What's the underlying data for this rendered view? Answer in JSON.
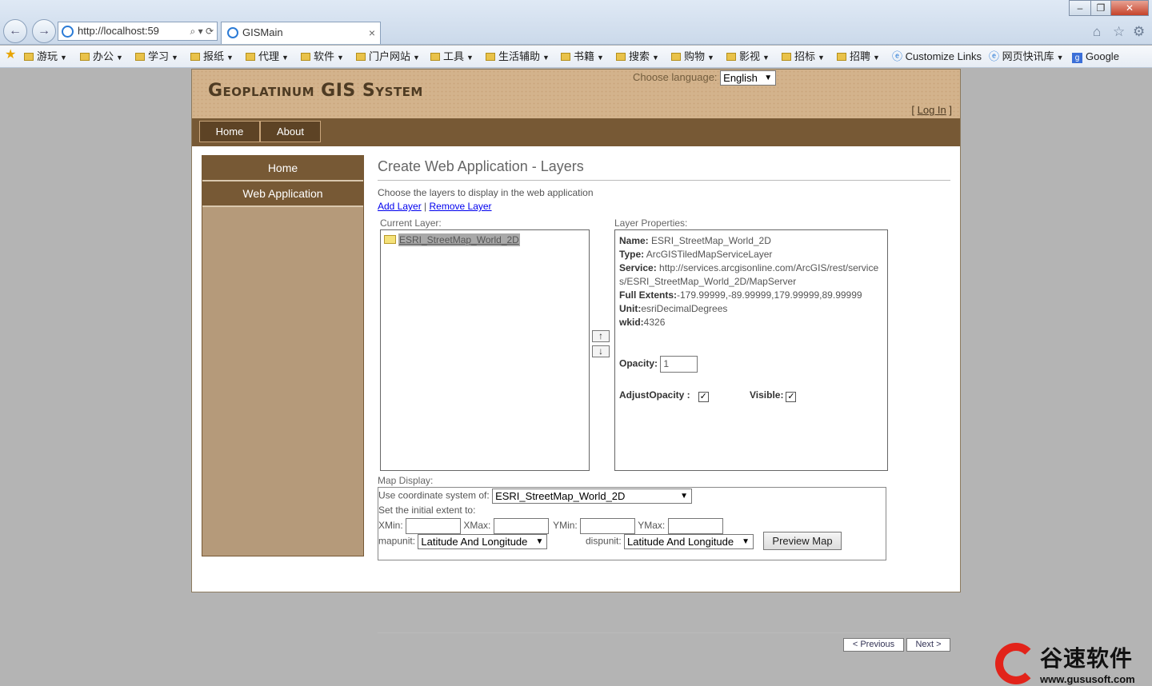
{
  "browser": {
    "address": "http://localhost:59",
    "tab_title": "GISMain",
    "tab_close": "×",
    "window_controls": {
      "minimize": "–",
      "maximize": "❐",
      "close": "✕"
    },
    "favorites": [
      {
        "label": "游玩"
      },
      {
        "label": "办公"
      },
      {
        "label": "学习"
      },
      {
        "label": "报纸"
      },
      {
        "label": "代理"
      },
      {
        "label": "软件"
      },
      {
        "label": "门户网站"
      },
      {
        "label": "工具"
      },
      {
        "label": "生活辅助"
      },
      {
        "label": "书籍"
      },
      {
        "label": "搜索"
      },
      {
        "label": "购物"
      },
      {
        "label": "影视"
      },
      {
        "label": "招标"
      },
      {
        "label": "招聘"
      }
    ],
    "fav_links": {
      "customize": "Customize Links",
      "quick": "网页快讯库",
      "google": "Google"
    }
  },
  "header": {
    "brand": "Geoplatinum GIS System",
    "language_label": "Choose language:",
    "language_value": "English",
    "login_prefix": "[ ",
    "login": "Log In",
    "login_suffix": " ]"
  },
  "menu": {
    "home": "Home",
    "about": "About"
  },
  "sidebar": {
    "items": [
      {
        "label": "Home"
      },
      {
        "label": "Web Application"
      }
    ]
  },
  "main": {
    "title": "Create Web Application - Layers",
    "hint": "Choose the layers to display in the web application",
    "add_layer": "Add Layer",
    "link_sep": " | ",
    "remove_layer": "Remove Layer",
    "current_layer_label": "Current Layer:",
    "current_layer_item": "ESRI_StreetMap_World_2D",
    "layer_props_label": "Layer Properties:",
    "up_arrow": "↑",
    "down_arrow": "↓",
    "props": {
      "name_label": "Name:",
      "name": "ESRI_StreetMap_World_2D",
      "type_label": "Type:",
      "type": "ArcGISTiledMapServiceLayer",
      "service_label": "Service:",
      "service_1": "http://services.arcgisonline.com/ArcGIS/rest/service",
      "service_2": "s/ESRI_StreetMap_World_2D/MapServer",
      "extents_label": "Full Extents:",
      "extents": "-179.99999,-89.99999,179.99999,89.99999",
      "unit_label": "Unit:",
      "unit": "esriDecimalDegrees",
      "wkid_label": "wkid:",
      "wkid": "4326",
      "opacity_label": "Opacity:",
      "opacity": "1",
      "adjust_label": "AdjustOpacity :",
      "adjust_checked": "✓",
      "visible_label": "Visible:",
      "visible_checked": "✓"
    },
    "map_display": {
      "label": "Map Display:",
      "coord_label": "Use coordinate system of:",
      "coord_value": "ESRI_StreetMap_World_2D",
      "extent_label": "Set the initial extent to:",
      "xmin": "XMin:",
      "xmax": "XMax:",
      "ymin": "YMin:",
      "ymax": "YMax:",
      "mapunit_label": "mapunit:",
      "mapunit_value": "Latitude And Longitude",
      "dispunit_label": "dispunit:",
      "dispunit_value": "Latitude And Longitude",
      "preview": "Preview Map"
    },
    "prev": "< Previous",
    "next": "Next >"
  },
  "watermark": {
    "text": "谷速软件",
    "url": "www.gususoft.com"
  }
}
